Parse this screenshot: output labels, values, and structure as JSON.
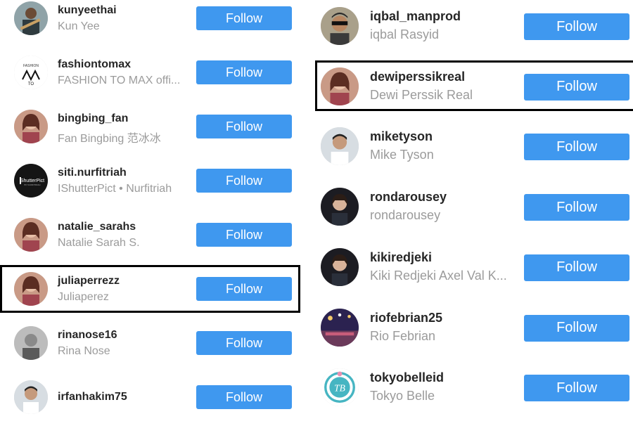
{
  "follow_label": "Follow",
  "colors": {
    "follow_button": "#3f98ef",
    "username": "#262626",
    "fullname": "#9b9b9b",
    "highlight": "#000000"
  },
  "left_column": [
    {
      "username": "kunyeethai",
      "fullname": "Kun Yee",
      "avatar": "profile-photo-man-guitar"
    },
    {
      "username": "fashiontomax",
      "fullname": "FASHION TO MAX offi...",
      "avatar": "fashion-to-max-logo"
    },
    {
      "username": "bingbing_fan",
      "fullname": "Fan Bingbing 范冰冰",
      "avatar": "profile-photo-woman"
    },
    {
      "username": "siti.nurfitriah",
      "fullname": "IShutterPict • Nurfitriah",
      "avatar": "ishutterpict-logo"
    },
    {
      "username": "natalie_sarahs",
      "fullname": "Natalie Sarah S.",
      "avatar": "profile-photo-woman"
    },
    {
      "username": "juliaperrezz",
      "fullname": "Juliaperez",
      "avatar": "profile-photo-woman",
      "highlighted": true
    },
    {
      "username": "rinanose16",
      "fullname": "Rina Nose",
      "avatar": "profile-photo-grayscale"
    },
    {
      "username": "irfanhakim75",
      "fullname": "",
      "avatar": "profile-photo-man"
    }
  ],
  "right_column": [
    {
      "username": "iqbal_manprod",
      "fullname": "iqbal Rasyid",
      "avatar": "profile-photo-man-sunglasses"
    },
    {
      "username": "dewiperssikreal",
      "fullname": "Dewi Perssik Real",
      "avatar": "profile-photo-woman",
      "highlighted": true
    },
    {
      "username": "miketyson",
      "fullname": "Mike Tyson",
      "avatar": "profile-photo-man"
    },
    {
      "username": "rondarousey",
      "fullname": "rondarousey",
      "avatar": "profile-photo-woman-dark"
    },
    {
      "username": "kikiredjeki",
      "fullname": "Kiki Redjeki Axel Val K...",
      "avatar": "profile-photo-woman-dark"
    },
    {
      "username": "riofebrian25",
      "fullname": "Rio Febrian",
      "avatar": "profile-photo-concert"
    },
    {
      "username": "tokyobelleid",
      "fullname": "Tokyo Belle",
      "avatar": "tokyo-belle-logo"
    }
  ]
}
